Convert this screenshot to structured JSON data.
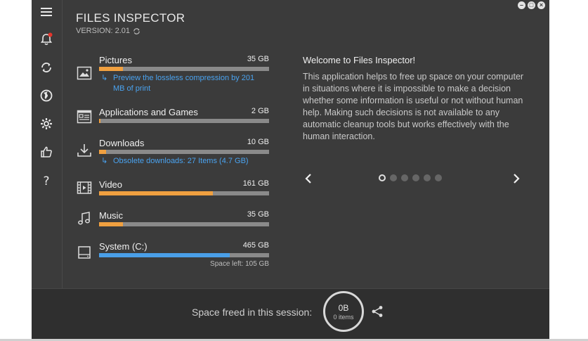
{
  "app": {
    "title": "FILES INSPECTOR",
    "version": "VERSION: 2.01"
  },
  "colors": {
    "background": "#3b3b3b",
    "accent_orange": "#f0a040",
    "accent_blue": "#4a9fe8",
    "link": "#4aa3f0"
  },
  "sidebar": {
    "items": [
      {
        "name": "menu-icon"
      },
      {
        "name": "notifications-icon",
        "badge": true
      },
      {
        "name": "refresh-icon"
      },
      {
        "name": "globe-icon"
      },
      {
        "name": "settings-icon"
      },
      {
        "name": "like-icon"
      },
      {
        "name": "help-icon"
      }
    ]
  },
  "categories": [
    {
      "name": "Pictures",
      "size": "35 GB",
      "fill_pct": 14,
      "icon": "image-icon",
      "hint": "Preview the lossless compression by 201 MB of print"
    },
    {
      "name": "Applications and Games",
      "size": "2 GB",
      "fill_pct": 1,
      "icon": "applications-icon"
    },
    {
      "name": "Downloads",
      "size": "10 GB",
      "fill_pct": 4,
      "icon": "download-icon",
      "hint": "Obsolete downloads: 27 Items (4.7 GB)"
    },
    {
      "name": "Video",
      "size": "161 GB",
      "fill_pct": 67,
      "icon": "video-icon"
    },
    {
      "name": "Music",
      "size": "35 GB",
      "fill_pct": 14,
      "icon": "music-icon"
    },
    {
      "name": "System (C:)",
      "size": "465 GB",
      "fill_pct": 77,
      "icon": "drive-icon",
      "space_left": "Space left: 105 GB"
    }
  ],
  "welcome": {
    "title": "Welcome to Files Inspector!",
    "body": "This application helps to free up space on your computer in situations where it is impossible to make a decision whether some information is useful or not without human help. Making such decisions is not available to any automatic cleanup tools but works effectively with the human interaction.",
    "slides": 6,
    "active_slide": 0
  },
  "footer": {
    "label": "Space freed in this session:",
    "value": "0B",
    "items": "0 items"
  },
  "window_controls": [
    "minimize",
    "maximize",
    "close"
  ]
}
